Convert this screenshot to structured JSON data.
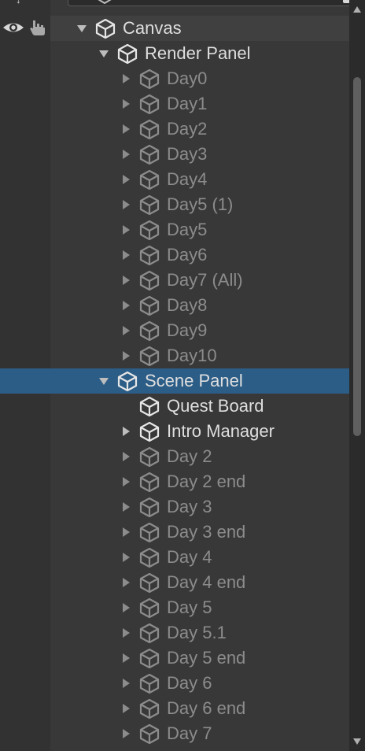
{
  "hierarchy": {
    "items": [
      {
        "label": "Canvas",
        "expanded": true,
        "has_children": true,
        "active": true,
        "selected": false,
        "depth": 0
      },
      {
        "label": "Render Panel",
        "expanded": true,
        "has_children": true,
        "active": true,
        "selected": false,
        "depth": 1
      },
      {
        "label": "Day0",
        "expanded": false,
        "has_children": true,
        "active": false,
        "selected": false,
        "depth": 2
      },
      {
        "label": "Day1",
        "expanded": false,
        "has_children": true,
        "active": false,
        "selected": false,
        "depth": 2
      },
      {
        "label": "Day2",
        "expanded": false,
        "has_children": true,
        "active": false,
        "selected": false,
        "depth": 2
      },
      {
        "label": "Day3",
        "expanded": false,
        "has_children": true,
        "active": false,
        "selected": false,
        "depth": 2
      },
      {
        "label": "Day4",
        "expanded": false,
        "has_children": true,
        "active": false,
        "selected": false,
        "depth": 2
      },
      {
        "label": "Day5 (1)",
        "expanded": false,
        "has_children": true,
        "active": false,
        "selected": false,
        "depth": 2
      },
      {
        "label": "Day5",
        "expanded": false,
        "has_children": true,
        "active": false,
        "selected": false,
        "depth": 2
      },
      {
        "label": "Day6",
        "expanded": false,
        "has_children": true,
        "active": false,
        "selected": false,
        "depth": 2
      },
      {
        "label": "Day7 (All)",
        "expanded": false,
        "has_children": true,
        "active": false,
        "selected": false,
        "depth": 2
      },
      {
        "label": "Day8",
        "expanded": false,
        "has_children": true,
        "active": false,
        "selected": false,
        "depth": 2
      },
      {
        "label": "Day9",
        "expanded": false,
        "has_children": true,
        "active": false,
        "selected": false,
        "depth": 2
      },
      {
        "label": "Day10",
        "expanded": false,
        "has_children": true,
        "active": false,
        "selected": false,
        "depth": 2
      },
      {
        "label": "Scene Panel",
        "expanded": true,
        "has_children": true,
        "active": true,
        "selected": true,
        "depth": 1
      },
      {
        "label": "Quest Board",
        "expanded": false,
        "has_children": false,
        "active": true,
        "selected": false,
        "depth": 2
      },
      {
        "label": "Intro Manager",
        "expanded": false,
        "has_children": true,
        "active": true,
        "selected": false,
        "depth": 2
      },
      {
        "label": "Day 2",
        "expanded": false,
        "has_children": true,
        "active": false,
        "selected": false,
        "depth": 2
      },
      {
        "label": "Day 2 end",
        "expanded": false,
        "has_children": true,
        "active": false,
        "selected": false,
        "depth": 2
      },
      {
        "label": "Day 3",
        "expanded": false,
        "has_children": true,
        "active": false,
        "selected": false,
        "depth": 2
      },
      {
        "label": "Day 3 end",
        "expanded": false,
        "has_children": true,
        "active": false,
        "selected": false,
        "depth": 2
      },
      {
        "label": "Day 4",
        "expanded": false,
        "has_children": true,
        "active": false,
        "selected": false,
        "depth": 2
      },
      {
        "label": "Day 4 end",
        "expanded": false,
        "has_children": true,
        "active": false,
        "selected": false,
        "depth": 2
      },
      {
        "label": "Day 5",
        "expanded": false,
        "has_children": true,
        "active": false,
        "selected": false,
        "depth": 2
      },
      {
        "label": "Day 5.1",
        "expanded": false,
        "has_children": true,
        "active": false,
        "selected": false,
        "depth": 2
      },
      {
        "label": "Day 5 end",
        "expanded": false,
        "has_children": true,
        "active": false,
        "selected": false,
        "depth": 2
      },
      {
        "label": "Day 6",
        "expanded": false,
        "has_children": true,
        "active": false,
        "selected": false,
        "depth": 2
      },
      {
        "label": "Day 6 end",
        "expanded": false,
        "has_children": true,
        "active": false,
        "selected": false,
        "depth": 2
      },
      {
        "label": "Day 7",
        "expanded": false,
        "has_children": true,
        "active": false,
        "selected": false,
        "depth": 2
      }
    ]
  },
  "icons": {
    "visibility": "eye-icon",
    "pickability": "hand-pointer-icon",
    "object": "cube-icon",
    "expand": "triangle-icon"
  },
  "colors": {
    "background": "#383838",
    "gutter": "#323232",
    "selection": "#2c5d87",
    "text_active": "#dedede",
    "text_inactive": "#8c8c8c",
    "scrollbar_track": "#2b2b2b",
    "scrollbar_thumb": "#5f5f5f"
  }
}
